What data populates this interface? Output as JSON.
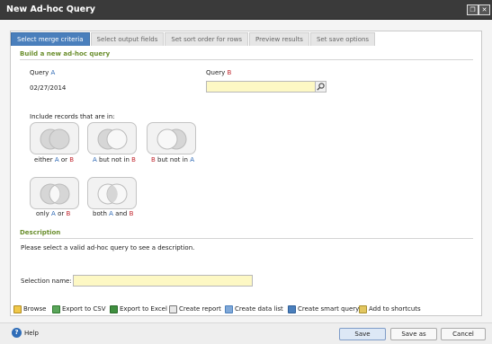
{
  "window": {
    "title": "New Ad-hoc Query",
    "max_glyph": "❐",
    "close_glyph": "✕"
  },
  "tabs": [
    {
      "label": "Select merge criteria",
      "active": true
    },
    {
      "label": "Select output fields",
      "active": false
    },
    {
      "label": "Set sort order for rows",
      "active": false
    },
    {
      "label": "Preview results",
      "active": false
    },
    {
      "label": "Set save options",
      "active": false
    }
  ],
  "build": {
    "heading": "Build a new ad-hoc query",
    "query_a_label": "Query",
    "query_a_letter": "A",
    "query_a_value": "02/27/2014",
    "query_b_label": "Query",
    "query_b_letter": "B",
    "query_b_value": "",
    "include_label": "Include records that are in:"
  },
  "venn": {
    "either": {
      "p1": "either ",
      "a": "A",
      "p2": " or ",
      "b": "B"
    },
    "a_not_b": {
      "a": "A",
      "p": " but not in ",
      "b": "B"
    },
    "b_not_a": {
      "b": "B",
      "p": " but not in ",
      "a": "A"
    },
    "only": {
      "p1": "only ",
      "a": "A",
      "p2": " or ",
      "b": "B"
    },
    "both": {
      "p1": "both ",
      "a": "A",
      "p2": " and ",
      "b": "B"
    }
  },
  "description": {
    "heading": "Description",
    "text": "Please select a valid ad-hoc query to see a description."
  },
  "selection": {
    "label": "Selection name:",
    "value": ""
  },
  "actions": [
    {
      "label": "Browse",
      "icon": "browse-icon"
    },
    {
      "label": "Export to CSV",
      "icon": "csv-icon"
    },
    {
      "label": "Export to Excel",
      "icon": "excel-icon"
    },
    {
      "label": "Create report",
      "icon": "report-icon"
    },
    {
      "label": "Create data list",
      "icon": "data-list-icon"
    },
    {
      "label": "Create smart query",
      "icon": "smart-query-icon"
    },
    {
      "label": "Add to shortcuts",
      "icon": "shortcut-icon"
    }
  ],
  "footer": {
    "help": "Help",
    "help_glyph": "?",
    "save": "Save",
    "save_as": "Save as",
    "cancel": "Cancel"
  },
  "colors": {
    "accent": "#4a7fbc",
    "section": "#6b8f2e",
    "field": "#fdf8c4",
    "a": "#2a66b3",
    "b": "#c0262e"
  }
}
